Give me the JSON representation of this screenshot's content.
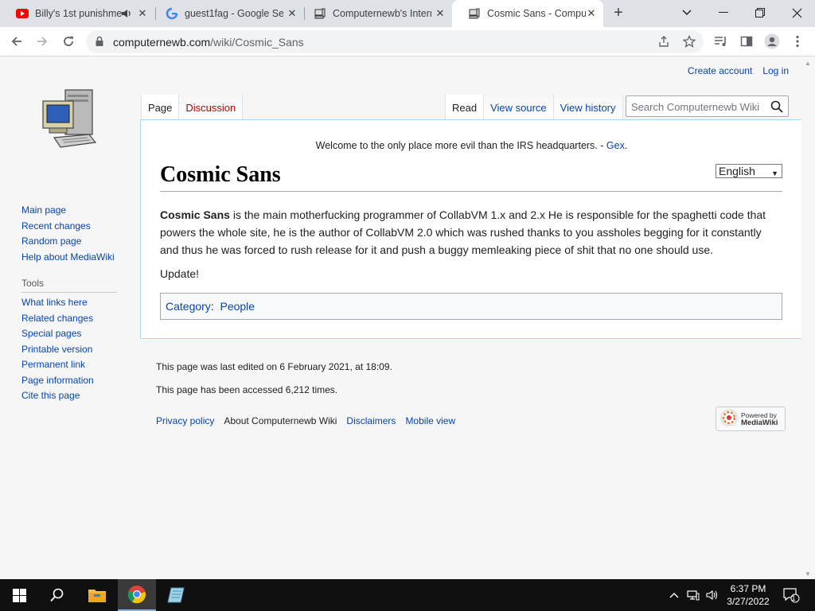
{
  "browser": {
    "tabs": [
      {
        "title": "Billy's 1st punishme",
        "favicon": "youtube-icon",
        "audio": true
      },
      {
        "title": "guest1fag - Google Se",
        "favicon": "google-icon"
      },
      {
        "title": "Computernewb's Intern",
        "favicon": "computernewb-icon"
      },
      {
        "title": "Cosmic Sans - Comput",
        "favicon": "computernewb-icon",
        "active": true
      }
    ],
    "url_domain": "computernewb.com",
    "url_path": "/wiki/Cosmic_Sans"
  },
  "wiki": {
    "user_links": {
      "create_account": "Create account",
      "login": "Log in"
    },
    "namespace_tabs": {
      "page": "Page",
      "discussion": "Discussion"
    },
    "view_tabs": {
      "read": "Read",
      "view_source": "View source",
      "view_history": "View history"
    },
    "search_placeholder": "Search Computernewb Wiki",
    "site_notice": "Welcome to the only place more evil than the IRS headquarters.",
    "site_notice_sep": " - ",
    "site_notice_link": "Gex",
    "site_notice_end": ".",
    "language": "English",
    "title": "Cosmic Sans",
    "intro_bold": "Cosmic Sans",
    "intro_text": " is the main motherfucking programmer of CollabVM 1.x and 2.x He is responsible for the spaghetti code that powers the whole site, he is the author of CollabVM 2.0 which was rushed thanks to you assholes begging for it constantly and thus he was forced to rush release for it and push a buggy memleaking piece of shit that no one should use.",
    "update": "Update!",
    "category_label": "Category",
    "category_colon": ":",
    "category": "People",
    "sidebar_nav": [
      "Main page",
      "Recent changes",
      "Random page",
      "Help about MediaWiki"
    ],
    "tools_header": "Tools",
    "tools": [
      "What links here",
      "Related changes",
      "Special pages",
      "Printable version",
      "Permanent link",
      "Page information",
      "Cite this page"
    ],
    "last_edited": "This page was last edited on 6 February 2021, at 18:09.",
    "accessed": "This page has been accessed 6,212 times.",
    "footer_links": [
      "Privacy policy",
      "About Computernewb Wiki",
      "Disclaimers",
      "Mobile view"
    ],
    "powered_by_line1": "Powered by",
    "powered_by_line2": "MediaWiki"
  },
  "taskbar": {
    "time": "6:37 PM",
    "date": "3/27/2022",
    "notification_count": "1"
  },
  "colors": {
    "link": "#0645ad",
    "new_link": "#ba0000",
    "taskbar": "#101010"
  }
}
